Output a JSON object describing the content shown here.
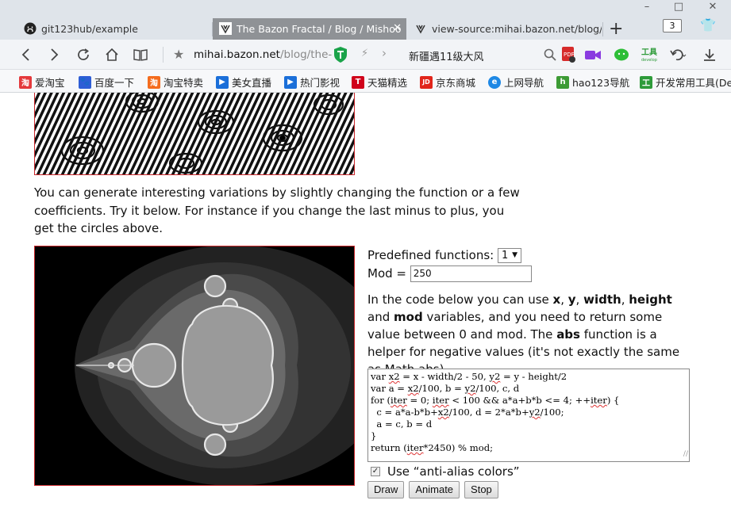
{
  "browser": {
    "tabs": [
      {
        "title": "git123hub/example",
        "active": false
      },
      {
        "title": "The Bazon Fractal / Blog / Mishoo",
        "active": true
      },
      {
        "title": "view-source:mihai.bazon.net/blog/",
        "active": false
      }
    ],
    "tab_count": "3",
    "address": {
      "host": "mihai.bazon.net",
      "path": "/blog/the-"
    },
    "news_ticker": "新疆遇11级大风",
    "icons": {
      "back": "back-icon",
      "forward": "forward-icon",
      "reload": "reload-icon",
      "home": "home-icon",
      "reader": "reader-icon"
    }
  },
  "bookmarks": [
    {
      "label": "爱淘宝",
      "icon_color": "#e4393c",
      "glyph": "淘"
    },
    {
      "label": "百度一下",
      "icon_color": "#2f5ed6",
      "glyph": "🐾"
    },
    {
      "label": "淘宝特卖",
      "icon_color": "#f46c1e",
      "glyph": "淘"
    },
    {
      "label": "美女直播",
      "icon_color": "#1b6fd9",
      "glyph": "▶"
    },
    {
      "label": "热门影视",
      "icon_color": "#1b6fd9",
      "glyph": "▶"
    },
    {
      "label": "天猫精选",
      "icon_color": "#d0021b",
      "glyph": "T"
    },
    {
      "label": "京东商城",
      "icon_color": "#e1251b",
      "glyph": "JD"
    },
    {
      "label": "上网导航",
      "icon_color": "#1e88e5",
      "glyph": "e"
    },
    {
      "label": "hao123导航",
      "icon_color": "#3d9b35",
      "glyph": "h"
    },
    {
      "label": "开发常用工具(Dev",
      "icon_color": "#2e9b3a",
      "glyph": "工"
    }
  ],
  "page": {
    "paragraph": "You can generate interesting variations by slightly changing the function or a few coefficients. Try it below. For instance if you change the last minus to plus, you get the circles above.",
    "predefined_label": "Predefined functions:",
    "predefined_value": "1",
    "mod_label": "Mod =",
    "mod_value": "250",
    "expl_1": "In the code below you can use ",
    "var_x": "x",
    "var_y": "y",
    "var_width": "width",
    "var_height": "height",
    "and": "and",
    "var_mod": "mod",
    "expl_2": " variables, and you need to return some value between 0 and mod. The ",
    "abs": "abs",
    "expl_3": " function is a helper for negative values (it's not exactly the same as Math.abs).",
    "code_lines": [
      "var x2 = x - width/2 - 50, y2 = y - height/2",
      "var a = x2/100, b = y2/100, c, d",
      "for (iter = 0; iter < 100 && a*a+b*b <= 4; ++iter) {",
      "  c = a*a-b*b+x2/100, d = 2*a*b+y2/100;",
      "  a = c, b = d",
      "}",
      "return (iter*2450) % mod;"
    ],
    "checkbox_label": "Use “anti-alias colors”",
    "checkbox_checked": true,
    "buttons": {
      "draw": "Draw",
      "animate": "Animate",
      "stop": "Stop"
    }
  }
}
